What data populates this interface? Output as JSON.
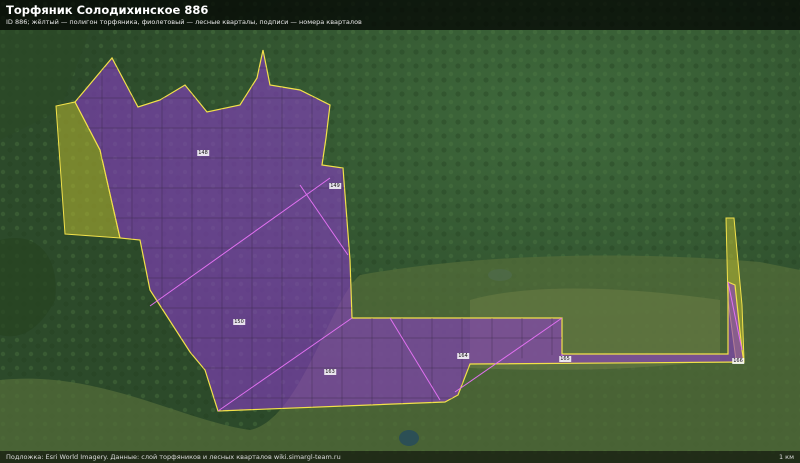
{
  "header": {
    "title": "Торфяник Солодихинское 886",
    "subtitle": "ID 886; жёлтый — полигон торфяника, фиолетовый — лесные кварталы, подписи — номера кварталов"
  },
  "footer": {
    "source": "Подложка: Esri World Imagery. Данные: слой торфяников и лесных кварталов wiki.simargl-team.ru",
    "scale": "1 км"
  },
  "colors": {
    "peat_outline": "#f2e14a",
    "peat_fill": "#b8b832",
    "quarter_fill": "#8a3cc8",
    "quarter_line": "#e070f0"
  },
  "quarter_labels": [
    "148",
    "149",
    "150",
    "163",
    "164",
    "165",
    "166",
    "167"
  ]
}
